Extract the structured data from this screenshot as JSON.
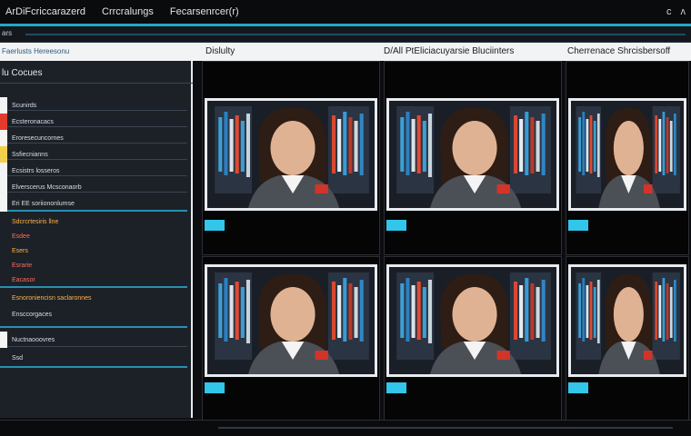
{
  "titlebar": {
    "menu": [
      "ArDiFcriccarazerd",
      "Crrcralungs",
      "Fecarsenrcer(r)"
    ],
    "right_glyph": "c",
    "close_glyph": "ʌ"
  },
  "subbar": {
    "tag": "ars"
  },
  "headers": {
    "sidebar": "Faerlusts Hereesonu",
    "col1": "Dislulty",
    "col2": "D/All PtEliciacuyarsie Bluciinters",
    "col3": "Cherrenace Shrcisbersoff"
  },
  "sidebar": {
    "title": "lu Cocues",
    "items": [
      {
        "label": "Scunirds",
        "swatch": "#f4f4f4",
        "tone": "normal"
      },
      {
        "label": "Ecsteronacacs",
        "swatch": "#e33a2c",
        "tone": "normal"
      },
      {
        "label": "Eroresecuncornes",
        "swatch": "#f4f4f4",
        "tone": "normal"
      },
      {
        "label": "Ssfiecnianns",
        "swatch": "#f2d04b",
        "tone": "normal"
      },
      {
        "label": "Ecsistrs losseros",
        "swatch": "#f4f4f4",
        "tone": "normal"
      },
      {
        "label": "Elverscerus Mcsconaorb",
        "swatch": "#f4f4f4",
        "tone": "normal"
      },
      {
        "label": "Eri EE soriiononlumse",
        "swatch": "#f4f4f4",
        "tone": "normal"
      },
      {
        "label": "Sdcrcrtesiris llne",
        "swatch": "",
        "tone": "amber"
      },
      {
        "label": "Esdee",
        "swatch": "",
        "tone": "red"
      },
      {
        "label": "Esers",
        "swatch": "",
        "tone": "amber"
      },
      {
        "label": "Esrarie",
        "swatch": "",
        "tone": "red"
      },
      {
        "label": "Eacasor",
        "swatch": "",
        "tone": "red"
      },
      {
        "label": "Esnoroniencisn saclaronnes",
        "swatch": "",
        "tone": "amber"
      },
      {
        "label": "Ensccorgaces",
        "swatch": "",
        "tone": "normal"
      },
      {
        "label": "Nuctnaooovres",
        "swatch": "#f4f4f4",
        "tone": "normal"
      },
      {
        "label": "Ssd",
        "swatch": "",
        "tone": "normal"
      }
    ]
  },
  "colors": {
    "accent": "#25a6c8",
    "tag": "#31c6ea"
  }
}
